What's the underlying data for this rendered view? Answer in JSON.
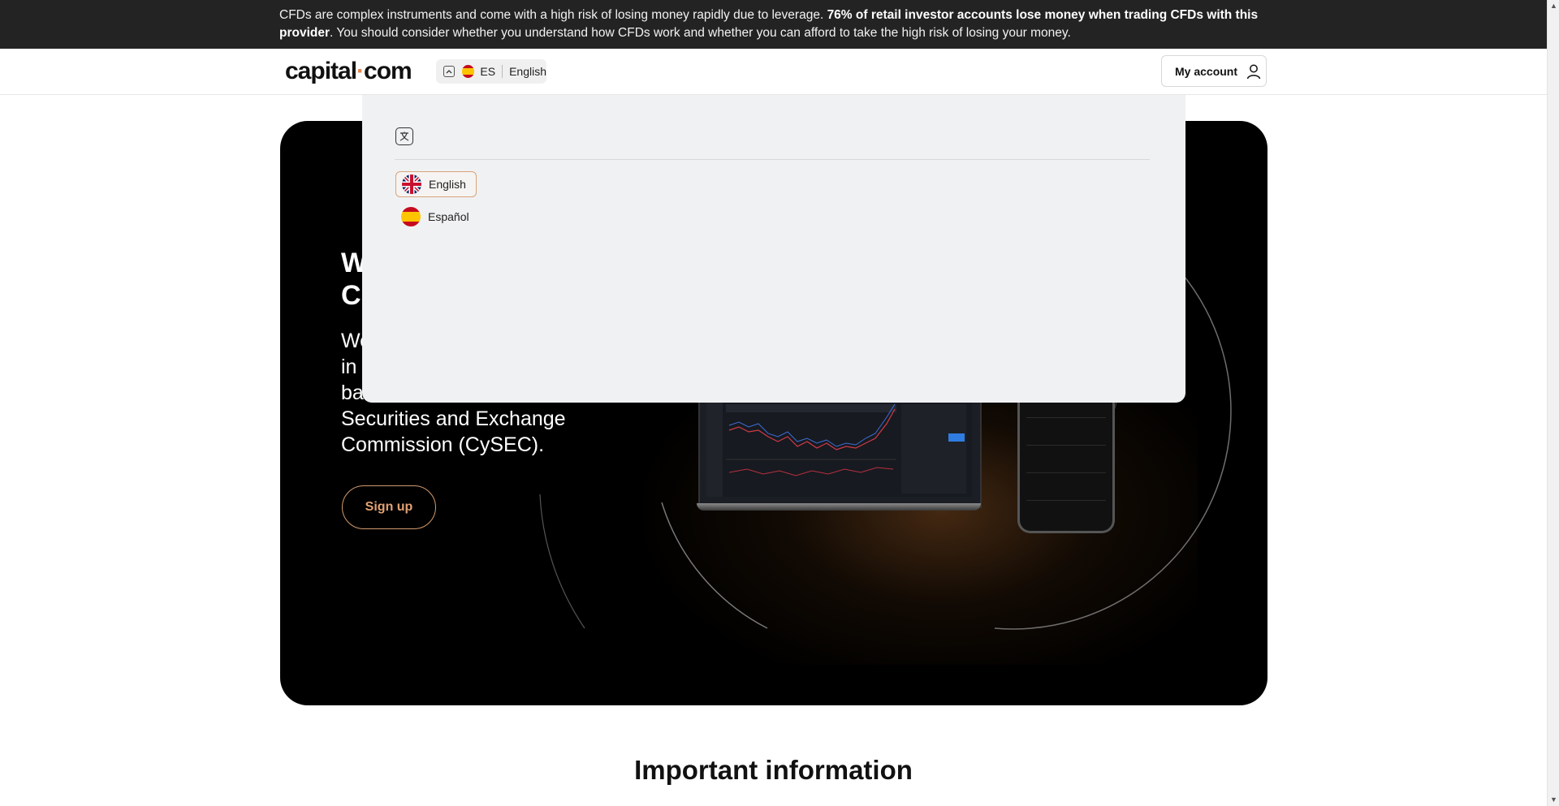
{
  "risk_warning": {
    "text_normal": "CFDs are complex instruments and come with a high risk of losing money rapidly due to leverage. ",
    "text_bold": "76% of retail investor accounts lose money when trading CFDs with this provider",
    "text_tail": ". You should consider whether you understand how CFDs work and whether you can afford to take the high risk of losing your money."
  },
  "header": {
    "logo_left": "capital",
    "logo_dot": "·",
    "logo_right": "com",
    "region_code": "ES",
    "language": "English",
    "account_label": "My account"
  },
  "language_menu": {
    "options": [
      {
        "label": "English",
        "selected": true,
        "icon": "uk-flag-icon"
      },
      {
        "label": "Español",
        "selected": false,
        "icon": "spain-flag-icon"
      }
    ]
  },
  "hero": {
    "title": "W\nC",
    "subtitle_visible": "We\nin\nba\nSecurities and Exchange\nCommission (CySEC).",
    "subtitle_line4": "Securities and Exchange",
    "subtitle_line5": "Commission (CySEC).",
    "signup_label": "Sign up"
  },
  "section": {
    "important_title": "Important information"
  },
  "colors": {
    "accent": "#e2844d",
    "dark_bar": "#232323",
    "hero_bg": "#000000",
    "dropdown_bg": "#f0f1f2"
  }
}
